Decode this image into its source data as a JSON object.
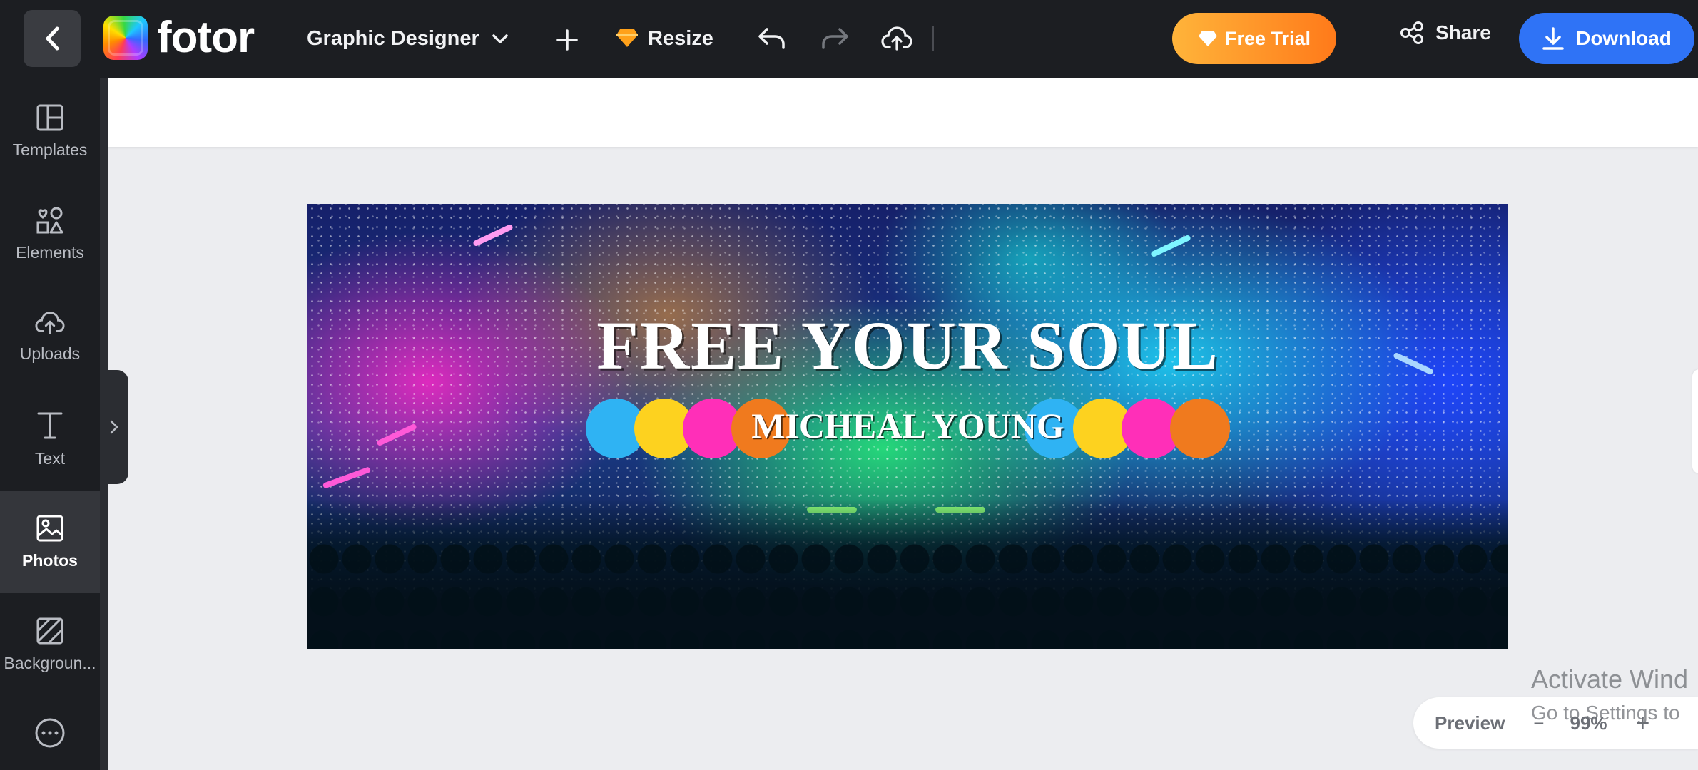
{
  "topbar": {
    "logo_text": "fotor",
    "project_name": "Graphic Designer",
    "resize_label": "Resize",
    "free_trial_label": "Free Trial",
    "share_label": "Share",
    "download_label": "Download"
  },
  "sidebar": {
    "items": [
      {
        "label": "Templates",
        "icon": "templates-icon"
      },
      {
        "label": "Elements",
        "icon": "elements-icon"
      },
      {
        "label": "Uploads",
        "icon": "uploads-icon"
      },
      {
        "label": "Text",
        "icon": "text-icon"
      },
      {
        "label": "Photos",
        "icon": "photos-icon",
        "active": true
      },
      {
        "label": "Backgroun...",
        "icon": "background-icon"
      },
      {
        "label": "",
        "icon": "more-icon"
      }
    ]
  },
  "banner": {
    "title": "FREE YOUR SOUL",
    "subtitle": "MICHEAL YOUNG",
    "dot_colors": [
      "#2fb3f3",
      "#fdd21f",
      "#ff2fb8",
      "#f07a1e"
    ]
  },
  "zoom": {
    "preview_label": "Preview",
    "minus": "−",
    "level": "99%",
    "plus": "+"
  },
  "watermark": {
    "line1": "Activate Wind",
    "line2": "Go to Settings to"
  },
  "colors": {
    "accent": "#2f73f6",
    "trial_gradient_start": "#ffb43a",
    "trial_gradient_end": "#ff7a1a",
    "topbar_bg": "#1c1e22"
  }
}
